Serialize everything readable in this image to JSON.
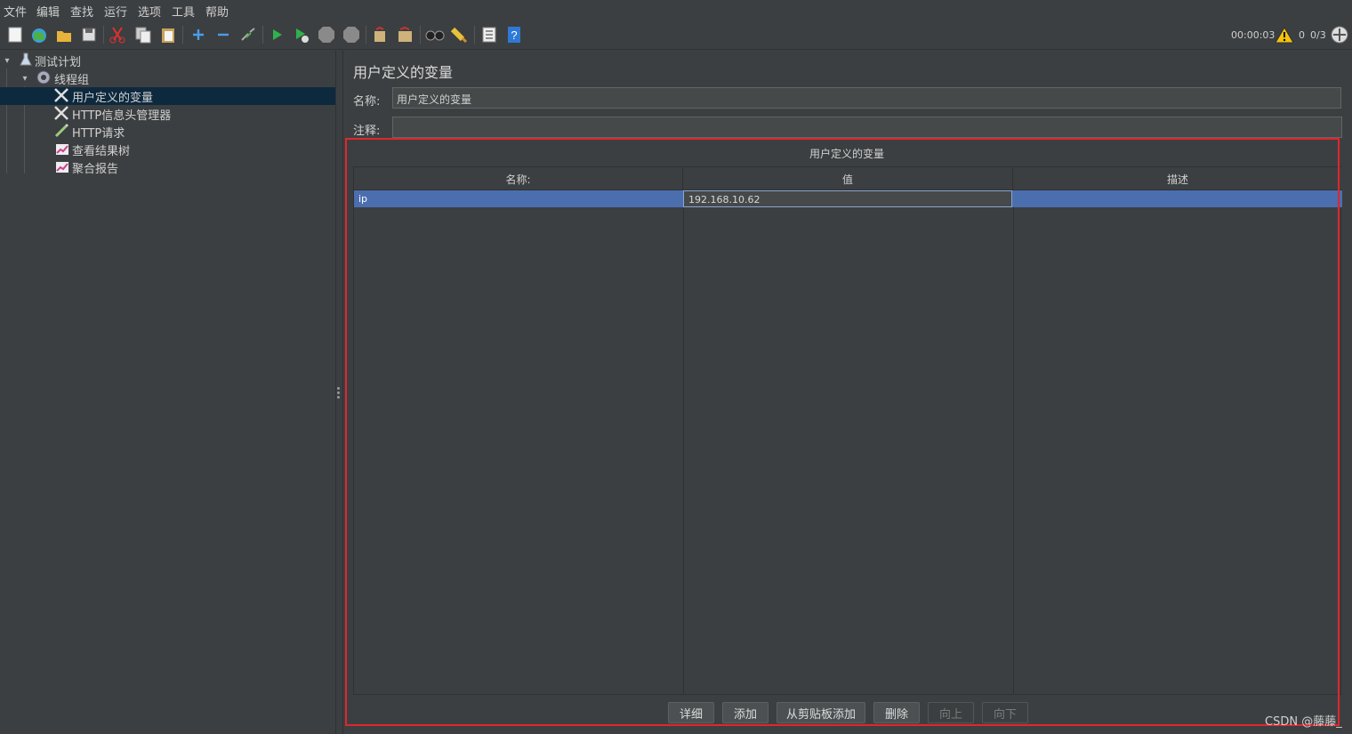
{
  "menu": [
    "文件",
    "编辑",
    "查找",
    "运行",
    "选项",
    "工具",
    "帮助"
  ],
  "toolbar": {
    "icons": [
      "new-icon",
      "templates-icon",
      "open-icon",
      "save-icon",
      "cut-icon",
      "copy-icon",
      "paste-icon",
      "expand-icon",
      "collapse-icon",
      "toggle-icon",
      "start-icon",
      "start-no-pause-icon",
      "stop-icon",
      "shutdown-icon",
      "clear-icon",
      "clear-all-icon",
      "search-icon",
      "reset-search-icon",
      "function-helper-icon",
      "help-icon"
    ],
    "timer": "00:00:03",
    "warnings": "0",
    "threads": "0/3"
  },
  "tree": {
    "items": [
      {
        "label": "测试计划",
        "icon": "flask-icon"
      },
      {
        "label": "线程组",
        "icon": "gear-icon"
      },
      {
        "label": "用户定义的变量",
        "icon": "tools-icon"
      },
      {
        "label": "HTTP信息头管理器",
        "icon": "tools-icon"
      },
      {
        "label": "HTTP请求",
        "icon": "pipette-icon"
      },
      {
        "label": "查看结果树",
        "icon": "chart-icon"
      },
      {
        "label": "聚合报告",
        "icon": "chart-icon"
      }
    ]
  },
  "panel": {
    "title": "用户定义的变量",
    "name_label": "名称:",
    "name_value": "用户定义的变量",
    "comment_label": "注释:",
    "comment_value": "",
    "table_title": "用户定义的变量",
    "columns": [
      "名称:",
      "值",
      "描述"
    ],
    "rows": [
      {
        "name": "ip",
        "value": "192.168.10.62",
        "desc": ""
      }
    ],
    "buttons": [
      "详细",
      "添加",
      "从剪贴板添加",
      "删除",
      "向上",
      "向下"
    ]
  },
  "watermark": "CSDN @藤藤_",
  "colors": {
    "background": "#3c3f41",
    "selection": "#4b6eaf",
    "highlight_border": "#e0262e"
  }
}
